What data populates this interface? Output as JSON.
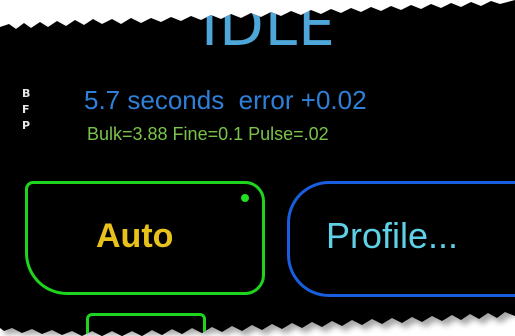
{
  "status": {
    "state": "IDLE"
  },
  "side_labels": [
    "B",
    "F",
    "P"
  ],
  "timing": {
    "text": "5.7 seconds  error +0.02"
  },
  "params": {
    "text": "Bulk=3.88 Fine=0.1 Pulse=.02"
  },
  "buttons": {
    "auto_label": "Auto",
    "profile_label": "Profile..."
  },
  "colors": {
    "panel_background": "#000000",
    "status_text": "#4fa6d8",
    "timing_text": "#2f7fd8",
    "params_text": "#7bc24a",
    "auto_border": "#1ed41e",
    "auto_text": "#e8c21a",
    "profile_border": "#1a5ee0",
    "profile_text": "#5fd0e6",
    "indicator_led": "#22e022"
  }
}
